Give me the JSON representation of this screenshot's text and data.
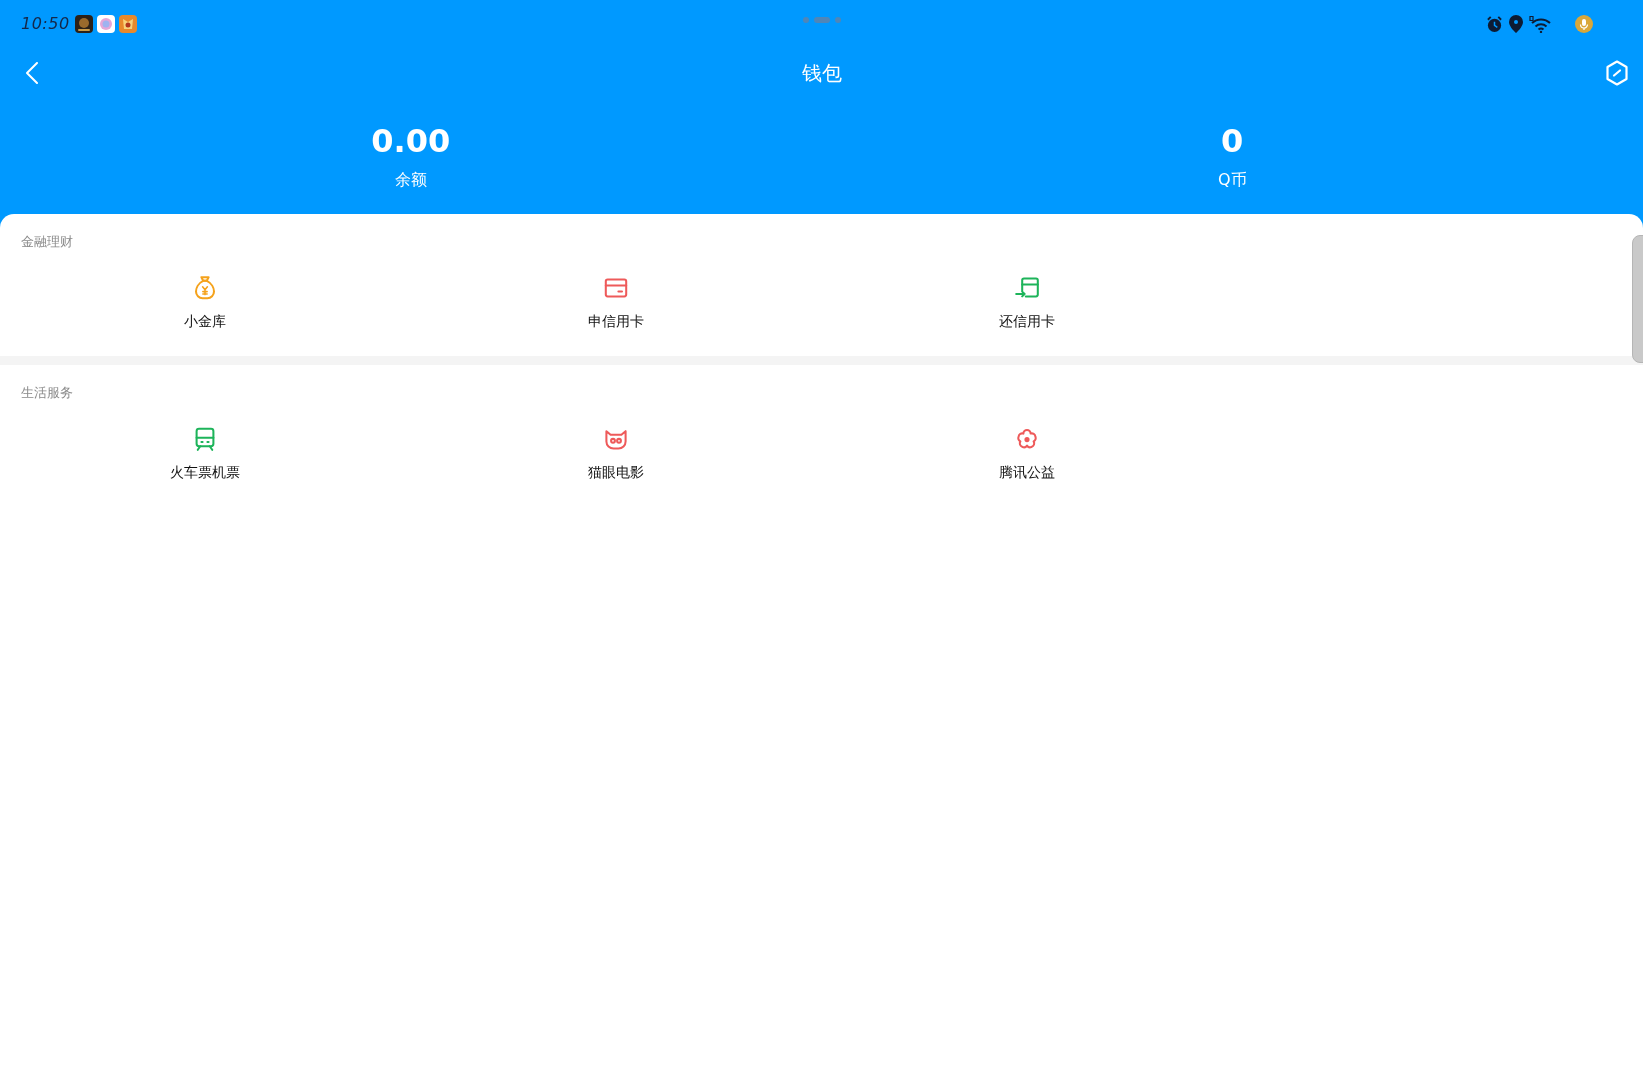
{
  "status_bar": {
    "time": "10:50"
  },
  "header": {
    "title": "钱包"
  },
  "balances": [
    {
      "value": "0.00",
      "label": "余额"
    },
    {
      "value": "0",
      "label": "Q币"
    }
  ],
  "sections": [
    {
      "title": "金融理财",
      "items": [
        {
          "label": "小金库",
          "color": "#f5a21b"
        },
        {
          "label": "申信用卡",
          "color": "#ee5a5a"
        },
        {
          "label": "还信用卡",
          "color": "#1db45a"
        }
      ]
    },
    {
      "title": "生活服务",
      "items": [
        {
          "label": "火车票机票",
          "color": "#1db45a"
        },
        {
          "label": "猫眼电影",
          "color": "#ee5a5a"
        },
        {
          "label": "腾讯公益",
          "color": "#ee5a5a"
        }
      ]
    }
  ]
}
